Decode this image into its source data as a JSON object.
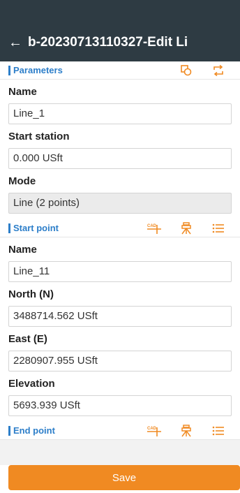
{
  "header": {
    "title": "b-20230713110327-Edit Li"
  },
  "sections": {
    "parameters": {
      "label": "Parameters",
      "icons": [
        "shape-select-icon",
        "swap-icon"
      ]
    },
    "start_point": {
      "label": "Start point",
      "icons": [
        "cad-pick-icon",
        "survey-pick-icon",
        "list-icon"
      ]
    },
    "end_point": {
      "label": "End point",
      "icons": [
        "cad-pick-icon",
        "survey-pick-icon",
        "list-icon"
      ]
    }
  },
  "fields": {
    "name": {
      "label": "Name",
      "value": "Line_1"
    },
    "start_station": {
      "label": "Start station",
      "value": "0.000 USft"
    },
    "mode": {
      "label": "Mode",
      "value": "Line (2 points)"
    },
    "start_name": {
      "label": "Name",
      "value": "Line_11"
    },
    "north": {
      "label": "North (N)",
      "value": "3488714.562 USft"
    },
    "east": {
      "label": "East (E)",
      "value": "2280907.955 USft"
    },
    "elevation": {
      "label": "Elevation",
      "value": "5693.939 USft"
    }
  },
  "save_label": "Save",
  "colors": {
    "header_bg": "#2e3b43",
    "accent_blue": "#2c7ec9",
    "accent_orange": "#f08a22"
  }
}
